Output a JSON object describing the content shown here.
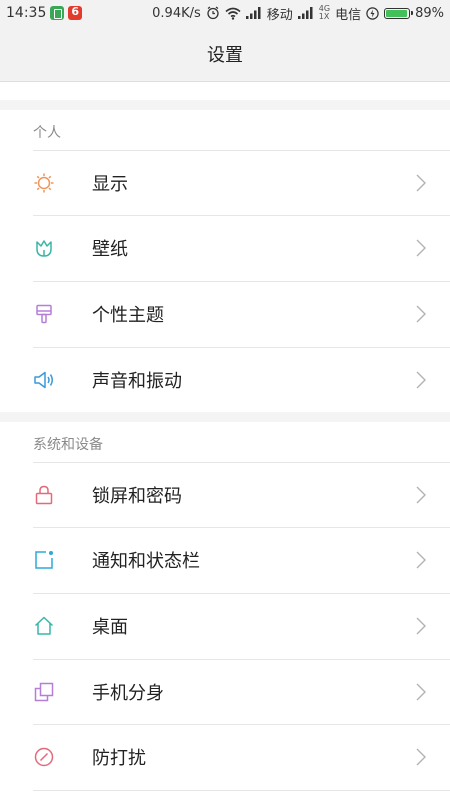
{
  "status_bar": {
    "time": "14:35",
    "speed": "0.94K/s",
    "carrier1": "移动",
    "net_top": "4G",
    "net_bottom": "1X",
    "carrier2": "电信",
    "battery_percent": "89%",
    "battery_level": 0.89
  },
  "header": {
    "title": "设置"
  },
  "sections": [
    {
      "title": "个人",
      "items": [
        {
          "label": "显示",
          "icon": "sun-icon",
          "color": "#f0955a"
        },
        {
          "label": "壁纸",
          "icon": "tulip-icon",
          "color": "#3ab5a5"
        },
        {
          "label": "个性主题",
          "icon": "paintbrush-icon",
          "color": "#b57fd8"
        },
        {
          "label": "声音和振动",
          "icon": "speaker-icon",
          "color": "#3a9ad9"
        }
      ]
    },
    {
      "title": "系统和设备",
      "items": [
        {
          "label": "锁屏和密码",
          "icon": "lock-icon",
          "color": "#e36a7b"
        },
        {
          "label": "通知和状态栏",
          "icon": "notification-icon",
          "color": "#2fa8d8"
        },
        {
          "label": "桌面",
          "icon": "home-icon",
          "color": "#3ab5a5"
        },
        {
          "label": "手机分身",
          "icon": "dual-space-icon",
          "color": "#b57fd8"
        },
        {
          "label": "防打扰",
          "icon": "do-not-disturb-icon",
          "color": "#e36a7b"
        }
      ]
    }
  ]
}
